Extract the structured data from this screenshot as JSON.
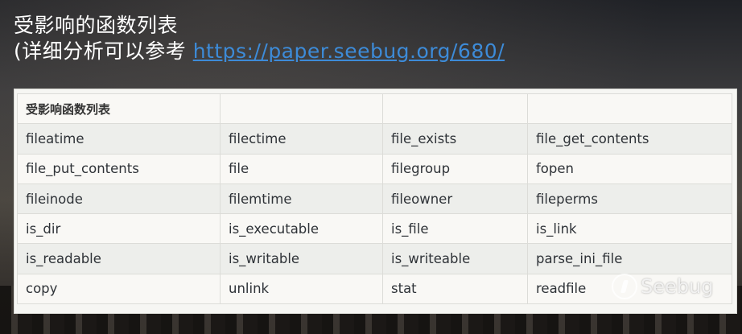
{
  "title": {
    "line1": "受影响的函数列表",
    "line2_prefix": "(详细分析可以参考 ",
    "link": "https://paper.seebug.org/680/"
  },
  "table": {
    "header": [
      "受影响函数列表",
      "",
      "",
      ""
    ],
    "rows": [
      [
        "fileatime",
        "filectime",
        "file_exists",
        "file_get_contents"
      ],
      [
        "file_put_contents",
        "file",
        "filegroup",
        "fopen"
      ],
      [
        "fileinode",
        "filemtime",
        "fileowner",
        "fileperms"
      ],
      [
        "is_dir",
        "is_executable",
        "is_file",
        "is_link"
      ],
      [
        "is_readable",
        "is_writable",
        "is_writeable",
        "parse_ini_file"
      ],
      [
        "copy",
        "unlink",
        "stat",
        "readfile"
      ]
    ]
  },
  "watermark": {
    "text": "Seebug",
    "icon": "seebug-logo-icon"
  }
}
